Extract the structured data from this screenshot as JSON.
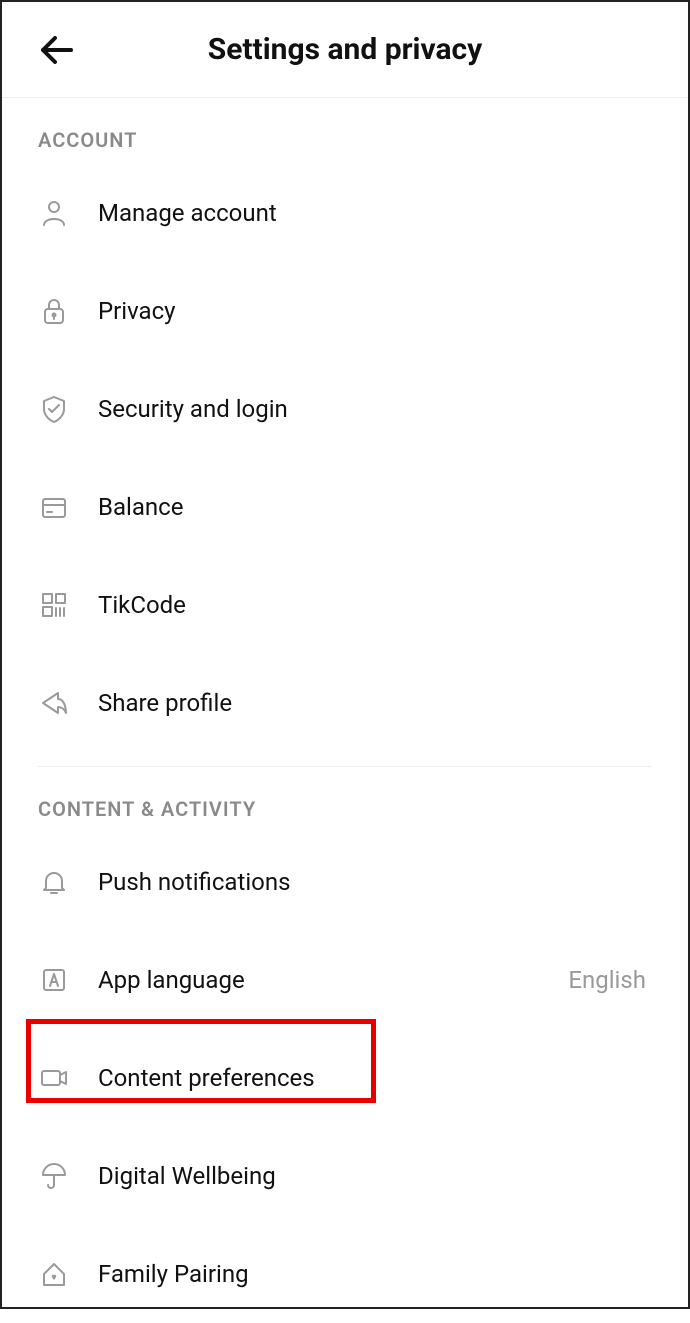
{
  "header": {
    "title": "Settings and privacy"
  },
  "sections": {
    "account": {
      "header": "ACCOUNT",
      "items": {
        "manage_account": {
          "label": "Manage account"
        },
        "privacy": {
          "label": "Privacy"
        },
        "security_login": {
          "label": "Security and login"
        },
        "balance": {
          "label": "Balance"
        },
        "tikcode": {
          "label": "TikCode"
        },
        "share_profile": {
          "label": "Share profile"
        }
      }
    },
    "content_activity": {
      "header": "CONTENT & ACTIVITY",
      "items": {
        "push_notifications": {
          "label": "Push notifications"
        },
        "app_language": {
          "label": "App language",
          "value": "English"
        },
        "content_preferences": {
          "label": "Content preferences"
        },
        "digital_wellbeing": {
          "label": "Digital Wellbeing"
        },
        "family_pairing": {
          "label": "Family Pairing"
        }
      }
    }
  },
  "highlight": {
    "target": "app_language"
  }
}
